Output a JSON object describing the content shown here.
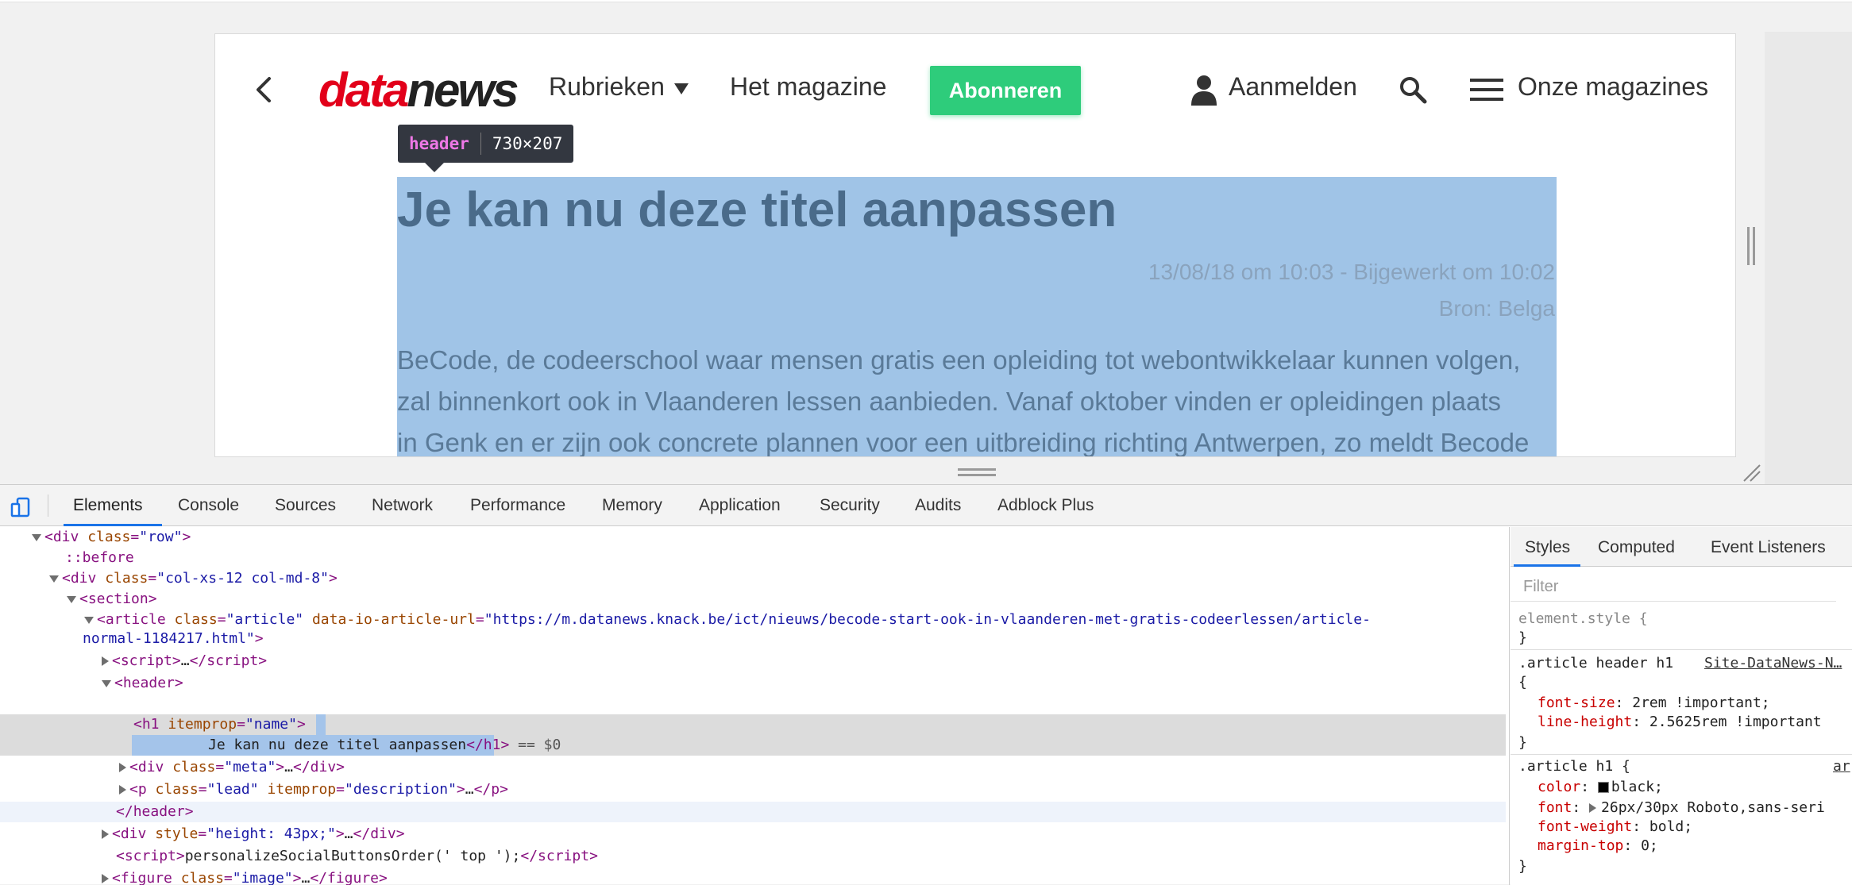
{
  "site": {
    "logo_part1": "data",
    "logo_part2": "news",
    "nav": {
      "rubrieken": "Rubrieken",
      "magazine": "Het magazine",
      "subscribe": "Abonneren",
      "login": "Aanmelden",
      "magazines": "Onze magazines"
    },
    "colors": {
      "logo_red": "#e2001a",
      "subscribe_green": "#2ecc7b",
      "highlight": "#a0c4e7"
    }
  },
  "inspector_tooltip": {
    "tag": "header",
    "size": "730×207"
  },
  "article": {
    "title": "Je kan nu deze titel aanpassen",
    "date": "13/08/18 om 10:03 - Bijgewerkt om 10:02",
    "source": "Bron: Belga",
    "lead_lines": [
      "BeCode, de codeerschool waar mensen gratis een opleiding tot webontwikkelaar kunnen volgen,",
      "zal binnenkort ook in Vlaanderen lessen aanbieden. Vanaf oktober vinden er opleidingen plaats",
      "in Genk en er zijn ook concrete plannen voor een uitbreiding richting Antwerpen, zo meldt Becode"
    ]
  },
  "devtools": {
    "tabs": [
      "Elements",
      "Console",
      "Sources",
      "Network",
      "Performance",
      "Memory",
      "Application",
      "Security",
      "Audits",
      "Adblock Plus"
    ],
    "active_tab": "Elements",
    "dom": {
      "l1_tag": "div",
      "l1_attr": "class",
      "l1_val": "row",
      "l2": "::before",
      "l3_tag": "div",
      "l3_attr": "class",
      "l3_val": "col-xs-12 col-md-8",
      "l4_tag": "section",
      "l5_tag": "article",
      "l5_attr1": "class",
      "l5_val1": "article",
      "l5_attr2": "data-io-article-url",
      "l5_val2a": "https://m.datanews.knack.be/ict/nieuws/becode-start-ook-in-vlaanderen-met-gratis-codeerlessen/article-",
      "l5_val2b": "normal-1184217.html",
      "l6_tag": "script",
      "l6_ellipsis": "…",
      "l6_close": "script",
      "l7_tag": "header",
      "l8_tag": "h1",
      "l8_attr": "itemprop",
      "l8_val": "name",
      "l9_text": "Je kan nu deze titel aanpassen",
      "l9_close": "h1",
      "l9_marker": "== $0",
      "l10_tag": "div",
      "l10_attr": "class",
      "l10_val": "meta",
      "l10_ellipsis": "…",
      "l10_close": "div",
      "l11_tag": "p",
      "l11_attr1": "class",
      "l11_val1": "lead",
      "l11_attr2": "itemprop",
      "l11_val2": "description",
      "l11_ellipsis": "…",
      "l11_close": "p",
      "l12_close": "header",
      "l13_tag": "div",
      "l13_attr": "style",
      "l13_val": "height: 43px;",
      "l13_ellipsis": "…",
      "l13_close": "div",
      "l14_tag": "script",
      "l14_text": "personalizeSocialButtonsOrder(' top ');",
      "l14_close": "script",
      "l15_tag": "figure",
      "l15_attr": "class",
      "l15_val": "image",
      "l15_ellipsis": "…",
      "l15_close": "figure"
    },
    "styles": {
      "tabs": [
        "Styles",
        "Computed",
        "Event Listeners"
      ],
      "filter_placeholder": "Filter",
      "element_style": "element.style {",
      "close_brace": "}",
      "rule1_selector": ".article header h1",
      "rule1_origin": "Site-DataNews-N…",
      "rule1_prop1": "font-size",
      "rule1_val1": "2rem !important;",
      "rule1_prop2": "line-height",
      "rule1_val2": "2.5625rem !important",
      "rule2_selector": ".article h1 {",
      "rule2_origin": "ar",
      "rule2_prop1": "color",
      "rule2_val1": "black;",
      "rule2_prop2": "font",
      "rule2_val2": "26px/30px Roboto,sans-seri",
      "rule2_prop3": "font-weight",
      "rule2_val3": "bold;",
      "rule2_prop4": "margin-top",
      "rule2_val4": "0;"
    }
  }
}
